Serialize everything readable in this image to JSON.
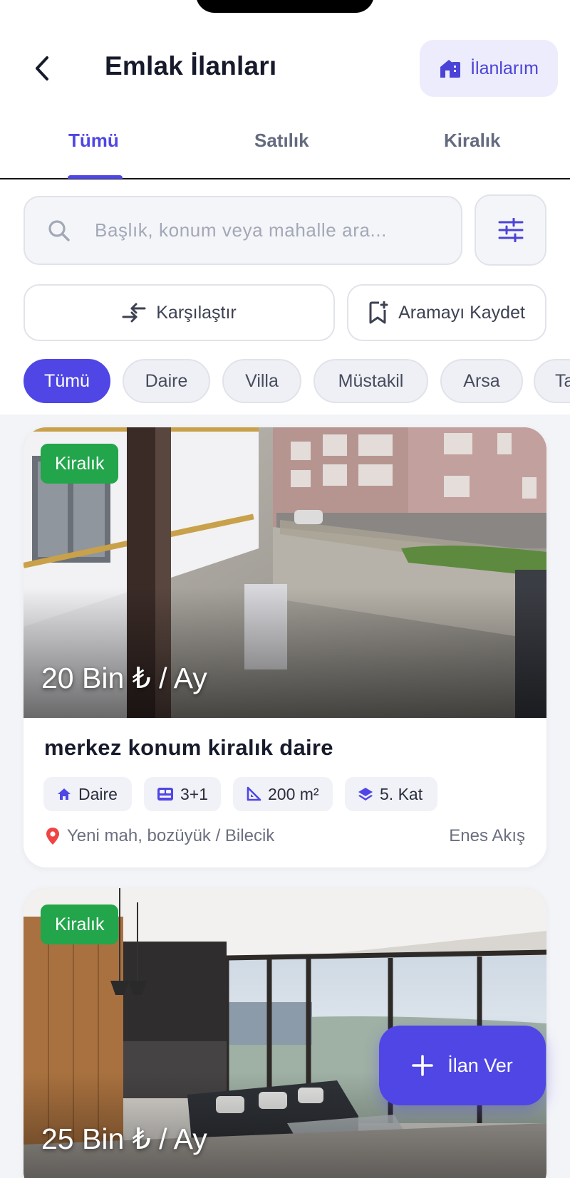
{
  "header": {
    "title": "Emlak İlanları",
    "my_listings_label": "İlanlarım"
  },
  "tabs": [
    {
      "label": "Tümü",
      "active": true
    },
    {
      "label": "Satılık",
      "active": false
    },
    {
      "label": "Kiralık",
      "active": false
    }
  ],
  "search": {
    "placeholder": "Başlık, konum veya mahalle ara..."
  },
  "actions": {
    "compare_label": "Karşılaştır",
    "save_search_label": "Aramayı Kaydet"
  },
  "categories": [
    {
      "label": "Tümü",
      "active": true
    },
    {
      "label": "Daire",
      "active": false
    },
    {
      "label": "Villa",
      "active": false
    },
    {
      "label": "Müstakil",
      "active": false
    },
    {
      "label": "Arsa",
      "active": false
    },
    {
      "label": "Ta",
      "active": false
    }
  ],
  "listings": [
    {
      "badge": "Kiralık",
      "price": "20 Bin ₺ / Ay",
      "title": "merkez konum kiralık daire",
      "specs": {
        "type": "Daire",
        "rooms": "3+1",
        "area": "200 m²",
        "floor": "5. Kat"
      },
      "location": "Yeni mah, bozüyük / Bilecik",
      "owner": "Enes Akış"
    },
    {
      "badge": "Kiralık",
      "price": "25 Bin ₺ / Ay"
    }
  ],
  "fab": {
    "label": "İlan Ver"
  },
  "colors": {
    "accent": "#4f46e5",
    "badge_green": "#22a54b",
    "location_pin": "#ef4444"
  },
  "icons": {
    "back": "chevron-left-icon",
    "my_listings": "building-icon",
    "search": "search-icon",
    "filter": "sliders-icon",
    "compare": "compare-arrows-icon",
    "save_search": "bookmark-plus-icon",
    "type": "home-icon",
    "rooms": "bed-icon",
    "area": "ruler-icon",
    "floor": "layers-icon",
    "location": "location-pin-icon",
    "fab": "plus-icon"
  }
}
